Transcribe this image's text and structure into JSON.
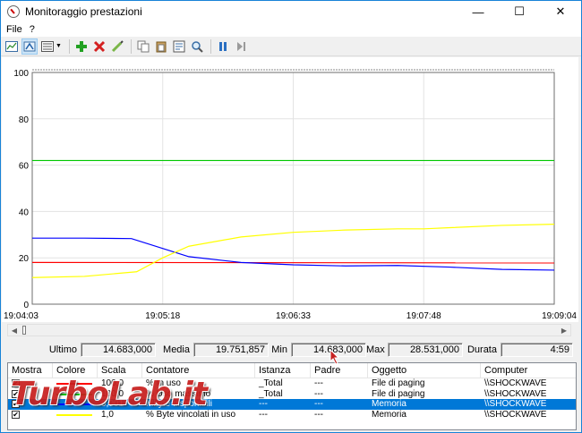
{
  "window": {
    "title": "Monitoraggio prestazioni",
    "controls": {
      "minimize": "—",
      "maximize": "☐",
      "close": "✕"
    }
  },
  "menu": [
    "File",
    "?"
  ],
  "toolbar": {
    "icons": [
      "view-graph-icon",
      "freeze-icon",
      "report-icon",
      "add-counter-icon",
      "delete-counter-icon",
      "highlight-icon",
      "copy-icon",
      "paste-icon",
      "properties-icon",
      "zoom-icon",
      "pause-icon",
      "step-icon"
    ]
  },
  "chart_data": {
    "type": "line",
    "ylim": [
      0,
      100
    ],
    "yticks": [
      "100",
      "80",
      "60",
      "40",
      "20",
      "0"
    ],
    "xticks": [
      "19:04:03",
      "19:05:18",
      "19:06:33",
      "19:07:48",
      "19:09:04"
    ],
    "series": [
      {
        "color": "#ff0000",
        "x": [
          0,
          100
        ],
        "values": [
          18,
          17.8
        ]
      },
      {
        "color": "#00c800",
        "x": [
          0,
          100
        ],
        "values": [
          62,
          62
        ]
      },
      {
        "color": "#0000ff",
        "x": [
          0,
          10,
          19,
          30,
          40,
          50,
          60,
          70,
          80,
          90,
          100
        ],
        "values": [
          28.5,
          28.5,
          28.3,
          20.5,
          18,
          17,
          16.5,
          16.7,
          16,
          15,
          14.7
        ]
      },
      {
        "color": "#ffff00",
        "x": [
          0,
          10,
          20,
          25,
          30,
          40,
          50,
          60,
          70,
          75,
          80,
          90,
          100
        ],
        "values": [
          11.5,
          12,
          14,
          20,
          25,
          29,
          31,
          32,
          32.5,
          32.5,
          33,
          34,
          34.5
        ]
      }
    ]
  },
  "stats": {
    "last_label": "Ultimo",
    "last": "14.683,000",
    "avg_label": "Media",
    "avg": "19.751,857",
    "min_label": "Min",
    "min": "14.683,000",
    "max_label": "Max",
    "max": "28.531,000",
    "duration_label": "Durata",
    "duration": "4:59"
  },
  "counters": {
    "headers": [
      "Mostra",
      "Colore",
      "Scala",
      "Contatore",
      "Istanza",
      "Padre",
      "Oggetto",
      "Computer"
    ],
    "rows": [
      {
        "color": "#ff0000",
        "scale": "100,0",
        "counter": "% In uso",
        "instance": "_Total",
        "parent": "---",
        "object": "File di paging",
        "computer": "\\\\SHOCKWAVE",
        "checked": "✔",
        "selected": false
      },
      {
        "color": "#00c800",
        "scale": "100,0",
        "counter": "% Uso massimo",
        "instance": "_Total",
        "parent": "---",
        "object": "File di paging",
        "computer": "\\\\SHOCKWAVE",
        "checked": "✔",
        "selected": false
      },
      {
        "color": "#0000ff",
        "scale": "0,001",
        "counter": "Mbyte disponibili",
        "instance": "---",
        "parent": "---",
        "object": "Memoria",
        "computer": "\\\\SHOCKWAVE",
        "checked": "✔",
        "selected": true
      },
      {
        "color": "#ffff00",
        "scale": "1,0",
        "counter": "% Byte vincolati in uso",
        "instance": "---",
        "parent": "---",
        "object": "Memoria",
        "computer": "\\\\SHOCKWAVE",
        "checked": "✔",
        "selected": false
      }
    ]
  },
  "watermark": "TurboLab.it"
}
